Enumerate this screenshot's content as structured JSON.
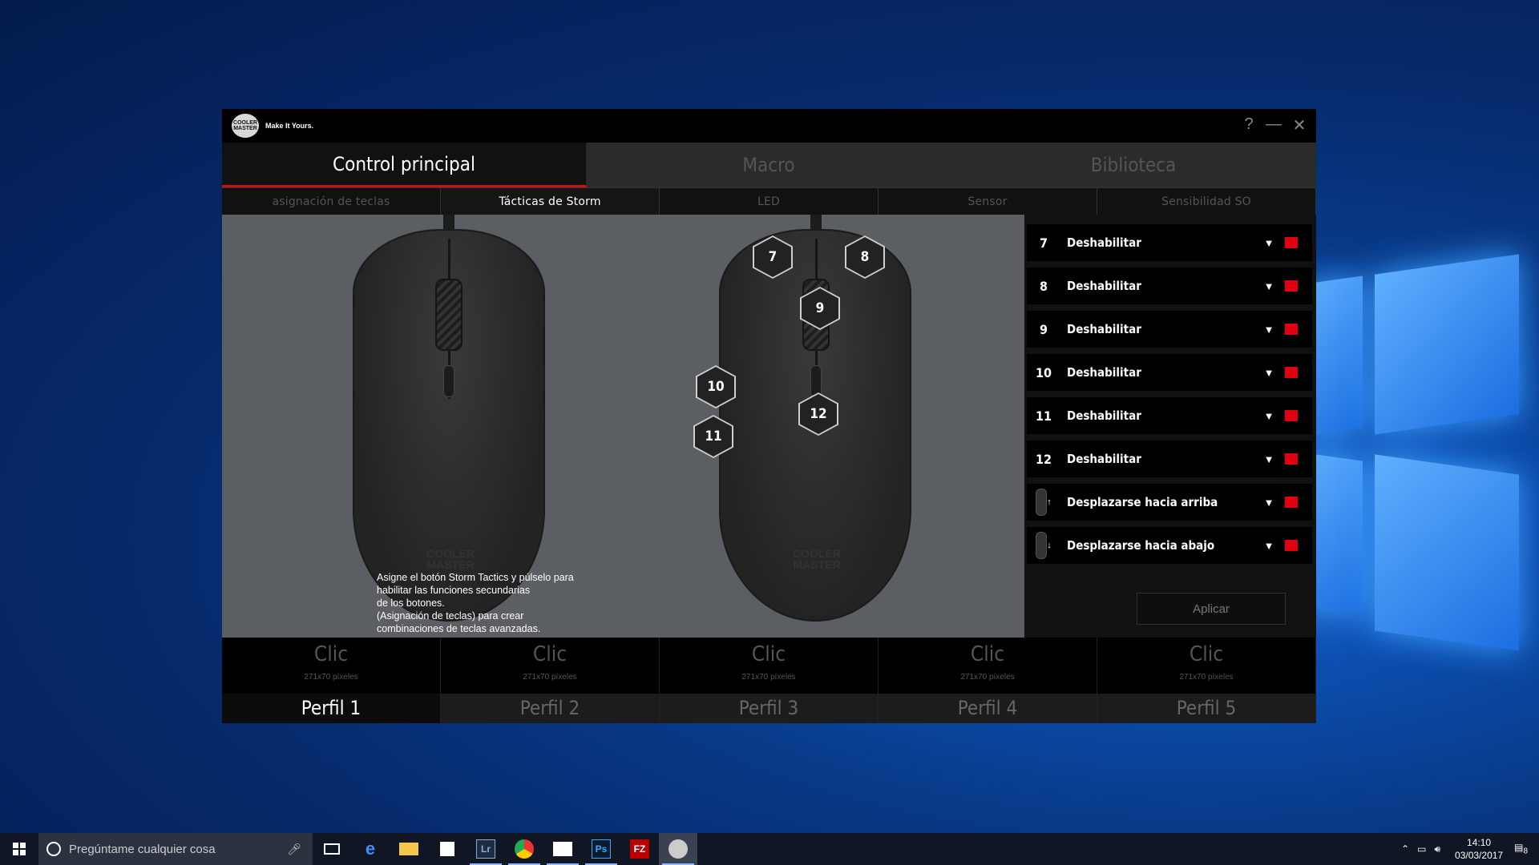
{
  "colors": {
    "accent_red": "#e00010",
    "tab_underline": "#cc1111",
    "window_bg": "#0b0b0b",
    "stage_bg": "#5b5e62"
  },
  "app": {
    "tagline": "Make It Yours.",
    "logo_text": "COOLER MASTER",
    "controls": {
      "help": "?",
      "minimize": "—",
      "close": "✕"
    },
    "main_tabs": [
      {
        "label": "Control principal",
        "active": true
      },
      {
        "label": "Macro",
        "active": false
      },
      {
        "label": "Biblioteca",
        "active": false
      }
    ],
    "sub_tabs": [
      {
        "label": "asignación de teclas"
      },
      {
        "label": "Tácticas de Storm"
      },
      {
        "label": "LED"
      },
      {
        "label": "Sensor"
      },
      {
        "label": "Sensibilidad SO"
      }
    ],
    "hint_lines": [
      "Asigne el botón Storm Tactics y púlselo para",
      "habilitar las funciones secundarias",
      "de los botones.",
      "(Asignación de teclas) para crear",
      "combinaciones de teclas avanzadas."
    ],
    "button_markers": [
      "7",
      "8",
      "9",
      "10",
      "11",
      "12"
    ],
    "assignments": [
      {
        "num": "7",
        "function": "Deshabilitar"
      },
      {
        "num": "8",
        "function": "Deshabilitar"
      },
      {
        "num": "9",
        "function": "Deshabilitar"
      },
      {
        "num": "10",
        "function": "Deshabilitar"
      },
      {
        "num": "11",
        "function": "Deshabilitar"
      },
      {
        "num": "12",
        "function": "Deshabilitar"
      },
      {
        "icon": "scroll-up-icon",
        "arrow": "↑",
        "function": "Desplazarse hacia arriba"
      },
      {
        "icon": "scroll-down-icon",
        "arrow": "↓",
        "function": "Desplazarse hacia abajo"
      }
    ],
    "apply_label": "Aplicar",
    "profiles": [
      {
        "clic": "Clic",
        "size": "271x70 píxeles",
        "name": "Perfil 1",
        "active": true
      },
      {
        "clic": "Clic",
        "size": "271x70 píxeles",
        "name": "Perfil 2"
      },
      {
        "clic": "Clic",
        "size": "271x70 píxeles",
        "name": "Perfil 3"
      },
      {
        "clic": "Clic",
        "size": "271x70 píxeles",
        "name": "Perfil 4"
      },
      {
        "clic": "Clic",
        "size": "271x70 píxeles",
        "name": "Perfil 5"
      }
    ]
  },
  "taskbar": {
    "search_placeholder": "Pregúntame cualquier cosa",
    "apps": [
      "task-view",
      "edge",
      "file-explorer",
      "store",
      "lightroom",
      "chrome",
      "photos",
      "photoshop",
      "filezilla",
      "cooler-master"
    ],
    "lightroom_label": "Lr",
    "photoshop_label": "Ps",
    "filezilla_label": "FZ",
    "time": "14:10",
    "date": "03/03/2017",
    "notifications": "8"
  }
}
